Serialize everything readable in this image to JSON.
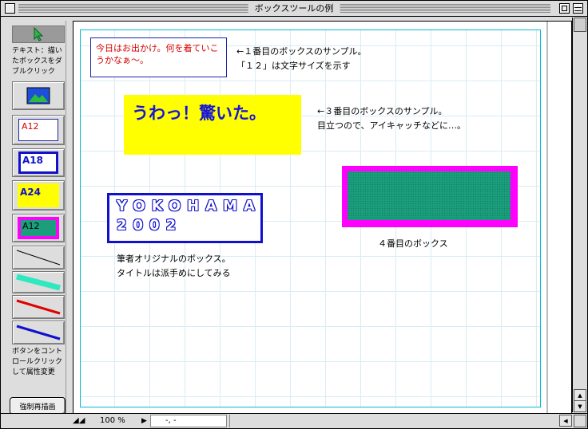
{
  "window": {
    "title": "ボックスツールの例"
  },
  "palette": {
    "hint_top": "テキスト：描いたボックスをダブルクリック",
    "tools": [
      {
        "name": "arrow",
        "icon": "arrow-cursor-icon"
      },
      {
        "name": "image",
        "icon": "picture-icon"
      },
      {
        "name": "text-a12",
        "label": "A12",
        "color": "#d40000"
      },
      {
        "name": "text-a18",
        "label": "A18",
        "color": "#1111cc"
      },
      {
        "name": "text-a24",
        "label": "A24",
        "color": "#ffff00"
      },
      {
        "name": "text-a12-fill",
        "label": "A12",
        "color": "#ff00ff"
      },
      {
        "name": "line-black",
        "color": "#000000"
      },
      {
        "name": "line-teal",
        "color": "#2ee8c0"
      },
      {
        "name": "line-red",
        "color": "#e00000"
      },
      {
        "name": "line-blue",
        "color": "#1111cc"
      }
    ],
    "hint_bottom": "ボタンをコントロールクリックして属性変更",
    "force_button": "強制再描画"
  },
  "canvas": {
    "box1_text": "今日はお出かけ。何を着ていこうかなぁ〜。",
    "note1": "←１番目のボックスのサンプル。\n「１２」は文字サイズを示す",
    "box3_text": "うわっ！驚いた。",
    "note3": "←３番目のボックスのサンプル。\n目立つので、アイキャッチなどに…。",
    "box2_line1": "YOKOHAMA",
    "box2_line2": "2002",
    "note2": "筆者オリジナルのボックス。\nタイトルは派手めにしてみる",
    "note4": "４番目のボックス"
  },
  "status": {
    "zoom": "100 %",
    "coord": "-, -"
  },
  "colors": {
    "accent_blue": "#1111cc",
    "yellow": "#ffff00",
    "magenta": "#ff00ff",
    "green_fill": "#1a9e7c",
    "red_text": "#d40000"
  }
}
